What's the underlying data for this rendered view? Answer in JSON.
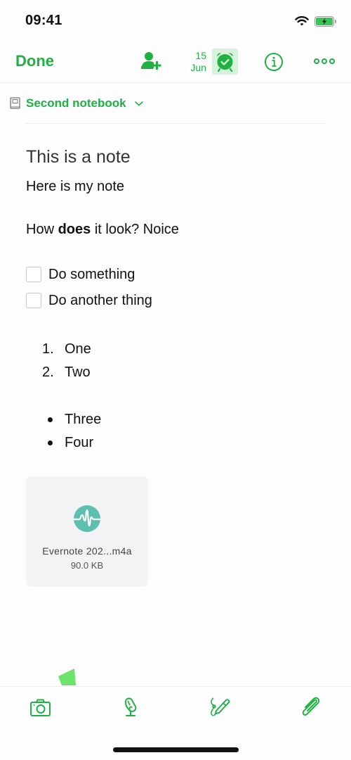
{
  "status_bar": {
    "time": "09:41",
    "wifi_icon": "wifi-icon",
    "battery_icon": "battery-charging-icon"
  },
  "colors": {
    "accent": "#1fb141",
    "reminder_bg": "#d7f3dc",
    "audio_icon": "#5cbfb0",
    "attachment_bg": "#f3f2f5"
  },
  "nav": {
    "done_label": "Done",
    "share_icon": "add-person-icon",
    "reminder_date": {
      "day": "15",
      "month": "Jun"
    },
    "reminder_icon": "alarm-clock-check-icon",
    "info_icon": "info-icon",
    "more_icon": "more-horizontal-icon"
  },
  "notebook": {
    "icon": "notebook-icon",
    "name": "Second notebook",
    "chevron": "chevron-down-icon"
  },
  "note": {
    "title": "This is a note",
    "paragraphs": [
      {
        "text": "Here is my note"
      },
      {
        "before": "How ",
        "bold": "does",
        "after": " it look? Noice"
      }
    ],
    "checklist": [
      {
        "label": "Do something",
        "checked": false
      },
      {
        "label": "Do another thing",
        "checked": false
      }
    ],
    "ordered_list": [
      {
        "marker": "1.",
        "text": "One"
      },
      {
        "marker": "2.",
        "text": "Two"
      }
    ],
    "bullet_list": [
      {
        "text": "Three"
      },
      {
        "text": "Four"
      }
    ],
    "attachment": {
      "icon": "audio-waveform-icon",
      "name": "Evernote 202...m4a",
      "size": "90.0 KB"
    }
  },
  "toolbar": {
    "items": [
      {
        "icon": "camera-icon"
      },
      {
        "icon": "microphone-icon"
      },
      {
        "icon": "sketch-pen-icon"
      },
      {
        "icon": "paperclip-icon"
      }
    ]
  }
}
